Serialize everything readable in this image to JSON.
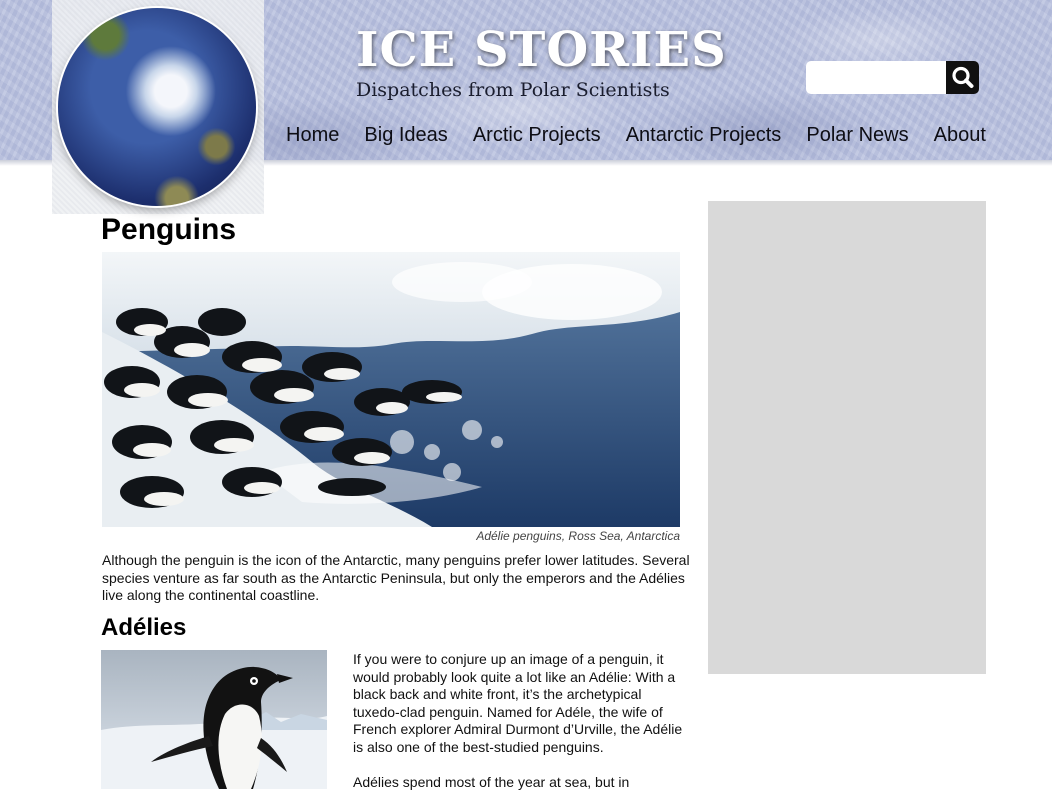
{
  "header": {
    "title": "ICE STORIES",
    "tagline": "Dispatches from Polar Scientists",
    "logo_icon": "globe-icon"
  },
  "search": {
    "placeholder": "",
    "button_icon": "search-icon"
  },
  "nav": {
    "items": [
      {
        "label": "Home"
      },
      {
        "label": "Big Ideas"
      },
      {
        "label": "Arctic Projects"
      },
      {
        "label": "Antarctic Projects"
      },
      {
        "label": "Polar News"
      },
      {
        "label": "About"
      }
    ]
  },
  "article": {
    "title": "Penguins",
    "hero_caption": "Adélie penguins, Ross Sea, Antarctica",
    "intro": "Although the penguin is the icon of the Antarctic, many penguins prefer lower latitudes. Several species venture as far south as the Antarctic Peninsula, but only the emperors and the Adélies live along the continental coastline.",
    "section_heading": "Adélies",
    "section_paragraphs": [
      "If you were to conjure up an image of a penguin, it would probably look quite a lot like an Adélie: With a black back and white front, it’s the archetypical tuxedo-clad penguin. Named for Adéle, the wife of French explorer Admiral Durmont d’Urville, the Adélie is also one of the best-studied penguins.",
      "Adélies spend most of the year at sea, but in"
    ]
  },
  "colors": {
    "header_bg": "#b8c0de",
    "sidebar_bg": "#d9d9d9",
    "search_button": "#101010"
  }
}
